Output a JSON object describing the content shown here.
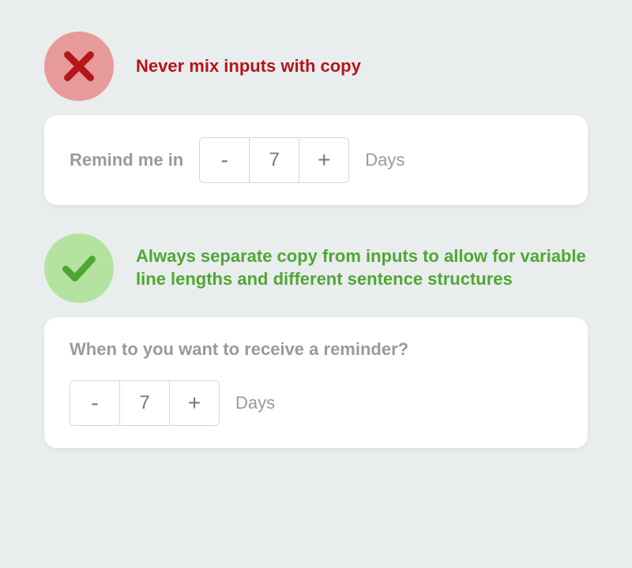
{
  "dont": {
    "heading": "Never mix inputs with copy",
    "example": {
      "prefix_label": "Remind me in",
      "value": "7",
      "unit": "Days"
    }
  },
  "do": {
    "heading": "Always separate copy from inputs to allow for variable line lengths and different sentence structures",
    "example": {
      "prompt": "When to you want to receive a reminder?",
      "value": "7",
      "unit": "Days"
    }
  },
  "icons": {
    "cross": "cross-icon",
    "check": "check-icon"
  },
  "colors": {
    "dont_text": "#b4161b",
    "dont_bg": "#e79a9a",
    "do_text": "#4fa733",
    "do_bg": "#b4e39f"
  }
}
